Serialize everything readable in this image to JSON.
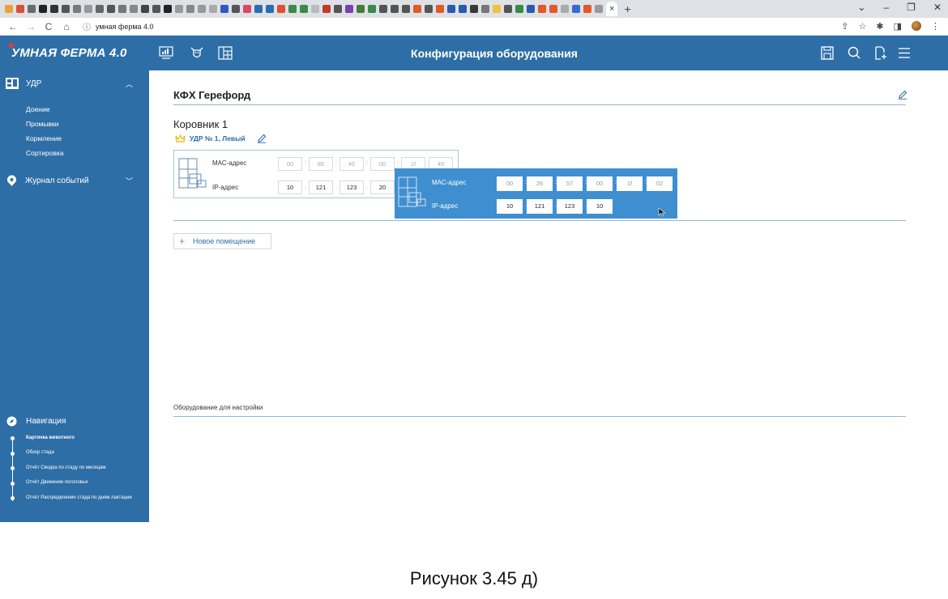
{
  "browser": {
    "tab_title": "",
    "tab_close": "×",
    "new_tab": "+",
    "window_controls": [
      "⌄",
      "–",
      "❐",
      "✕"
    ],
    "url": "умная ферма 4.0",
    "tab_icon_colors": [
      "#e8a23a",
      "#d94f3a",
      "#6b6b6b",
      "#222",
      "#333",
      "#555",
      "#7a7a7a",
      "#999",
      "#666",
      "#555",
      "#777",
      "#888",
      "#444",
      "#555",
      "#222",
      "#999",
      "#888",
      "#999",
      "#aaa",
      "#3157c4",
      "#555",
      "#d9486b",
      "#2b6cb0",
      "#2b6cb0",
      "#e04f2f",
      "#3a8a4a",
      "#3a8a4a",
      "#bbb",
      "#c0392b",
      "#555",
      "#7b3fb0",
      "#4a7a3a",
      "#3a8a4a",
      "#555",
      "#555",
      "#555",
      "#e05a2a",
      "#555",
      "#e05a2a",
      "#2a5ab0",
      "#2a5ab0",
      "#3a3a3a",
      "#777",
      "#f0c040",
      "#555",
      "#3a8a4a",
      "#2a5ab0",
      "#e05a2a",
      "#e05a2a",
      "#aaa",
      "#3a6ad0",
      "#e05a2a",
      "#999"
    ]
  },
  "app": {
    "logo_text": "УМНАЯ ФЕРМА 4.0",
    "header_title": "Конфигурация оборудования",
    "header_left_icons": [
      "monitor-chart-icon",
      "cow-icon",
      "layout-grid-icon"
    ],
    "header_right_icons": [
      "save-icon",
      "search-icon",
      "add-file-icon",
      "menu-icon"
    ],
    "colors": {
      "primary": "#2e6ea6",
      "drag_card": "#3f8fd0",
      "accent_green": "#4caf50",
      "crown": "#f2b705"
    }
  },
  "sidebar": {
    "udr": {
      "label": "УДР",
      "items": [
        "Доение",
        "Промывки",
        "Кормление",
        "Сортировка"
      ]
    },
    "journal": {
      "label": "Журнал событий"
    },
    "navigation": {
      "label": "Навигация",
      "items": [
        "Карточка животного",
        "Обзор стада",
        "Отчёт Сводка по стаду по месяцам",
        "Отчёт Движение поголовья",
        "Отчёт Распределение стада по дням лактации"
      ]
    }
  },
  "main": {
    "farm_title": "КФХ Герефорд",
    "barn_title": "Коровник 1",
    "udr_label": "УДР № 1, Левый",
    "device1": {
      "mac_label": "МАС-адрес",
      "ip_label": "IP-адрес",
      "mac": [
        "00",
        "85",
        "45",
        "00",
        "1f",
        "45"
      ],
      "ip": [
        "10",
        "121",
        "123",
        "20"
      ]
    },
    "device2": {
      "mac_label": "МАС-адрес",
      "ip_label": "IP-адрес",
      "mac": [
        "00",
        "26",
        "57",
        "00",
        "1f",
        "02"
      ],
      "ip": [
        "10",
        "121",
        "123",
        "10"
      ]
    },
    "new_room_label": "Новое помещение",
    "equipment_label": "Оборудование для настройки"
  },
  "caption": "Рисунок 3.45 д)"
}
